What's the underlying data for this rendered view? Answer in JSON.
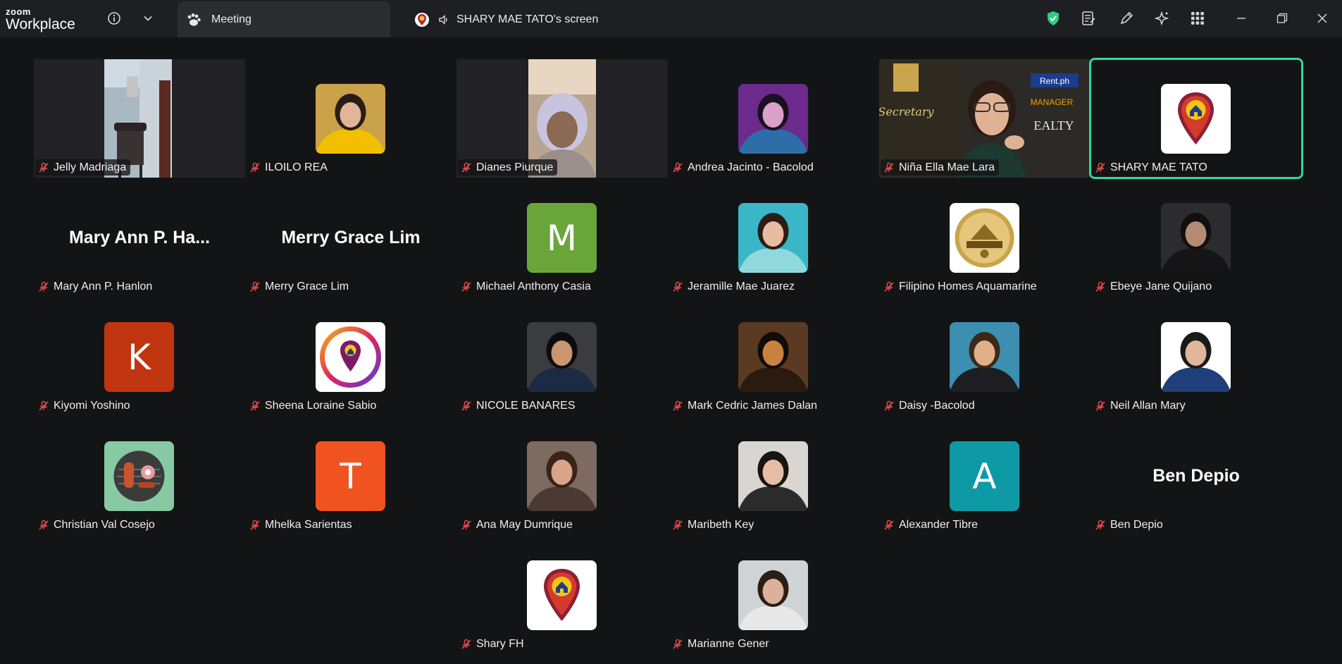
{
  "app": {
    "brand_small": "zoom",
    "brand_big": "Workplace",
    "meeting_tab": "Meeting",
    "share_tab": "SHARY MAE TATO's screen"
  },
  "colors": {
    "active_border": "#33d69f",
    "shield": "#2fcf82",
    "mic_muted": "#e04b4b"
  },
  "participants": [
    {
      "name": "Jelly Madriaga",
      "kind": "video",
      "scene": "room"
    },
    {
      "name": "ILOILO REA",
      "kind": "photo",
      "photo": "woman-yellow"
    },
    {
      "name": "Dianes Piurque",
      "kind": "video",
      "scene": "person"
    },
    {
      "name": "Andrea Jacinto - Bacolod",
      "kind": "photo",
      "photo": "lights"
    },
    {
      "name": "Niña Ella Mae Lara",
      "kind": "video",
      "scene": "banner"
    },
    {
      "name": "SHARY MAE TATO",
      "kind": "logo",
      "active": true
    },
    {
      "name": "Mary Ann P. Hanlon",
      "kind": "text",
      "display": "Mary Ann P. Ha..."
    },
    {
      "name": "Merry Grace Lim",
      "kind": "text",
      "display": "Merry Grace Lim"
    },
    {
      "name": "Michael Anthony Casia",
      "kind": "letter",
      "letter": "M",
      "color": "#6aa53a"
    },
    {
      "name": "Jeramille Mae Juarez",
      "kind": "photo",
      "photo": "teal-selfie"
    },
    {
      "name": "Filipino Homes Aquamarine",
      "kind": "photo",
      "photo": "aquamarine-badge"
    },
    {
      "name": "Ebeye Jane Quijano",
      "kind": "photo",
      "photo": "woman-dark"
    },
    {
      "name": "Kiyomi Yoshino",
      "kind": "letter",
      "letter": "K",
      "color": "#c0350f"
    },
    {
      "name": "Sheena Loraine Sabio",
      "kind": "logo-ring"
    },
    {
      "name": "NICOLE BANARES",
      "kind": "photo",
      "photo": "graduate"
    },
    {
      "name": "Mark Cedric James Dalan",
      "kind": "photo",
      "photo": "man-warm"
    },
    {
      "name": "Daisy -Bacolod",
      "kind": "photo",
      "photo": "woman-teal"
    },
    {
      "name": "Neil Allan Mary",
      "kind": "photo",
      "photo": "man-suit"
    },
    {
      "name": "Christian Val Cosejo",
      "kind": "photo",
      "photo": "bbq"
    },
    {
      "name": "Mhelka Sarientas",
      "kind": "letter",
      "letter": "T",
      "color": "#f0531f"
    },
    {
      "name": "Ana May Dumrique",
      "kind": "photo",
      "photo": "woman-face"
    },
    {
      "name": "Maribeth Key",
      "kind": "photo",
      "photo": "woman-light"
    },
    {
      "name": "Alexander Tibre",
      "kind": "letter",
      "letter": "A",
      "color": "#0e9aa5"
    },
    {
      "name": "Ben Depio",
      "kind": "text",
      "display": "Ben Depio"
    },
    {
      "name": "Shary FH",
      "kind": "logo"
    },
    {
      "name": "Marianne Gener",
      "kind": "photo",
      "photo": "woman-office"
    }
  ]
}
